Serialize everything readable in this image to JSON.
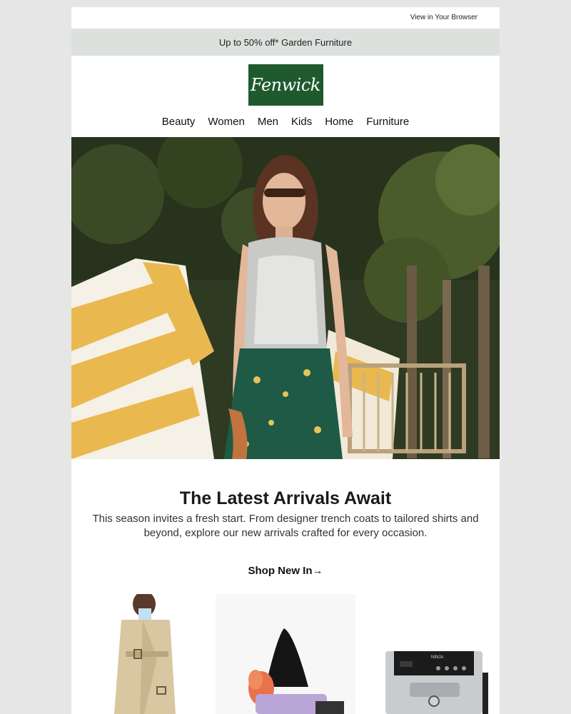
{
  "header": {
    "view_in_browser": "View in Your Browser",
    "promo": "Up to 50% off* Garden Furniture",
    "logo_text": "Fenwick",
    "brand_color": "#1f5a2e"
  },
  "nav": {
    "items": [
      "Beauty",
      "Women",
      "Men",
      "Kids",
      "Home",
      "Furniture"
    ]
  },
  "intro": {
    "title": "The Latest Arrivals Await",
    "body": "This season invites a fresh start. From designer trench coats to tailored shirts and beyond, explore our new arrivals crafted for every occasion.",
    "cta": "Shop New In→"
  },
  "products": [
    {
      "name": "trench-coat"
    },
    {
      "name": "black-knit-hat"
    },
    {
      "name": "coffee-machine",
      "brand_text": "NINJA"
    }
  ]
}
